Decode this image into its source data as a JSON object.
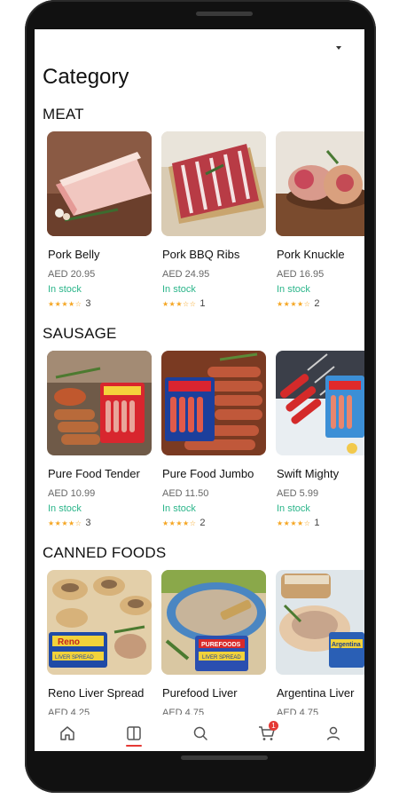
{
  "page": {
    "title": "Category"
  },
  "sections": [
    {
      "title": "MEAT",
      "items": [
        {
          "name": "Pork Belly",
          "price": "AED 20.95",
          "stock": "In stock",
          "stars": "★★★★☆",
          "reviews": "3"
        },
        {
          "name": "Pork BBQ Ribs",
          "price": "AED 24.95",
          "stock": "In stock",
          "stars": "★★★☆☆",
          "reviews": "1"
        },
        {
          "name": "Pork Knuckle",
          "price": "AED 16.95",
          "stock": "In stock",
          "stars": "★★★★☆",
          "reviews": "2"
        }
      ]
    },
    {
      "title": "SAUSAGE",
      "items": [
        {
          "name": "Pure Food Tender",
          "price": "AED 10.99",
          "stock": "In stock",
          "stars": "★★★★☆",
          "reviews": "3"
        },
        {
          "name": "Pure Food Jumbo",
          "price": "AED 11.50",
          "stock": "In stock",
          "stars": "★★★★☆",
          "reviews": "2"
        },
        {
          "name": "Swift Mighty",
          "price": "AED 5.99",
          "stock": "In stock",
          "stars": "★★★★☆",
          "reviews": "1"
        }
      ]
    },
    {
      "title": "CANNED FOODS",
      "items": [
        {
          "name": "Reno Liver Spread",
          "price": "AED 4.25",
          "brand": "Reno",
          "subtext": "LIVER SPREAD"
        },
        {
          "name": "Purefood Liver",
          "price": "AED 4.75",
          "brand": "PUREFOODS",
          "subtext": "LIVER SPREAD"
        },
        {
          "name": "Argentina Liver",
          "price": "AED 4.75",
          "brand": "Argentina"
        }
      ]
    }
  ],
  "nav": {
    "items": [
      "home-icon",
      "category-icon",
      "search-icon",
      "cart-icon",
      "profile-icon"
    ],
    "active": "category-icon",
    "cart_count": "1",
    "accent": "#e53935"
  },
  "colors": {
    "stock": "#2bb58a",
    "star": "#f5a623"
  }
}
